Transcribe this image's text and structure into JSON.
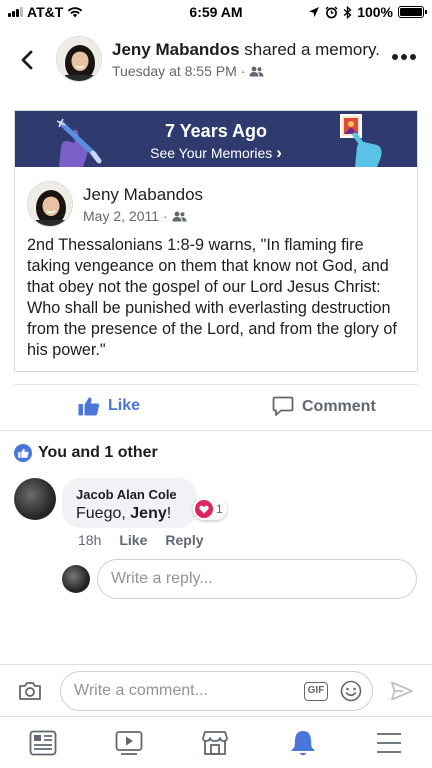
{
  "status_bar": {
    "carrier": "AT&T",
    "time": "6:59 AM",
    "battery": "100%"
  },
  "header": {
    "author": "Jeny Mabandos",
    "action": " shared a memory.",
    "timestamp": "Tuesday at 8:55 PM",
    "separator": "·",
    "audience_icon": "friends-icon"
  },
  "memory": {
    "banner_title": "7 Years Ago",
    "banner_link": "See Your Memories",
    "banner_chevron": "›",
    "post_author": "Jeny Mabandos",
    "post_date": "May 2, 2011",
    "separator": "·",
    "post_text": "2nd Thessalonians 1:8-9 warns, \"In flaming fire taking vengeance on them that know not God, and that obey not the gospel of our Lord Jesus Christ: Who shall be punished with everlasting destruction from the presence of the Lord, and from the glory of his power.\""
  },
  "actions": {
    "like_label": "Like",
    "comment_label": "Comment"
  },
  "reactions": {
    "summary": "You and 1 other"
  },
  "comment": {
    "author": "Jacob Alan Cole",
    "text_prefix": "Fuego, ",
    "text_mention": "Jeny",
    "text_suffix": "!",
    "reaction_count": "1",
    "time": "18h",
    "like_label": "Like",
    "reply_label": "Reply"
  },
  "reply": {
    "placeholder": "Write a reply..."
  },
  "composer": {
    "placeholder": "Write a comment...",
    "gif_label": "GIF"
  },
  "tab_bar": {
    "tabs": [
      "news-feed-icon",
      "watch-icon",
      "marketplace-icon",
      "notifications-icon",
      "menu-icon"
    ],
    "active_color": "#4a76d9"
  },
  "colors": {
    "brand_blue": "#4a76d9",
    "banner_bg": "#2f3b6e",
    "love_red": "#e0245e"
  }
}
